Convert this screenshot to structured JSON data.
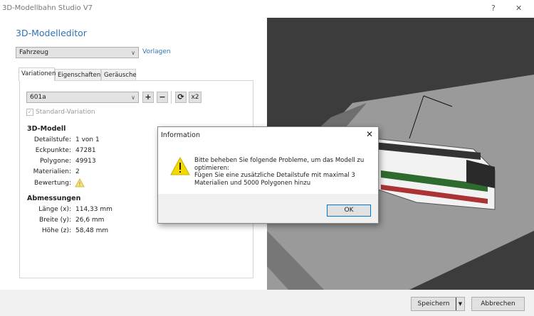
{
  "window": {
    "title": "3D-Modellbahn Studio V7",
    "help": "?",
    "close": "✕"
  },
  "editor": {
    "title": "3D-Modelleditor",
    "type_select": "Fahrzeug",
    "templates_link": "Vorlagen"
  },
  "tabs": [
    {
      "label": "Variationen",
      "active": true
    },
    {
      "label": "Eigenschaften"
    },
    {
      "label": "Geräusche"
    }
  ],
  "variation": {
    "select": "601a",
    "add": "+",
    "remove": "−",
    "refresh": "⟳",
    "double": "x2",
    "standard_label": "Standard-Variation",
    "standard_checked": true
  },
  "model": {
    "heading": "3D-Modell",
    "rows": [
      {
        "label": "Detailstufe:",
        "value": "1 von 1"
      },
      {
        "label": "Eckpunkte:",
        "value": "47281"
      },
      {
        "label": "Polygone:",
        "value": "49913"
      },
      {
        "label": "Materialien:",
        "value": "2"
      },
      {
        "label": "Bewertung:",
        "value": "",
        "icon": "warning-icon"
      }
    ]
  },
  "dimensions": {
    "heading": "Abmessungen",
    "rows": [
      {
        "label": "Länge (x):",
        "value": "114,33 mm"
      },
      {
        "label": "Breite (y):",
        "value": "26,6 mm"
      },
      {
        "label": "Höhe (z):",
        "value": "58,48 mm"
      }
    ]
  },
  "dialog": {
    "title": "Information",
    "close": "✕",
    "line1": "Bitte beheben Sie folgende Probleme, um das Modell zu",
    "line2": "optimieren:",
    "line3": "Fügen Sie eine zusätzliche Detailstufe mit maximal 3",
    "line4": "Materialien und 5000 Polygonen hinzu",
    "ok": "OK"
  },
  "footer": {
    "save": "Speichern",
    "cancel": "Abbrechen"
  }
}
